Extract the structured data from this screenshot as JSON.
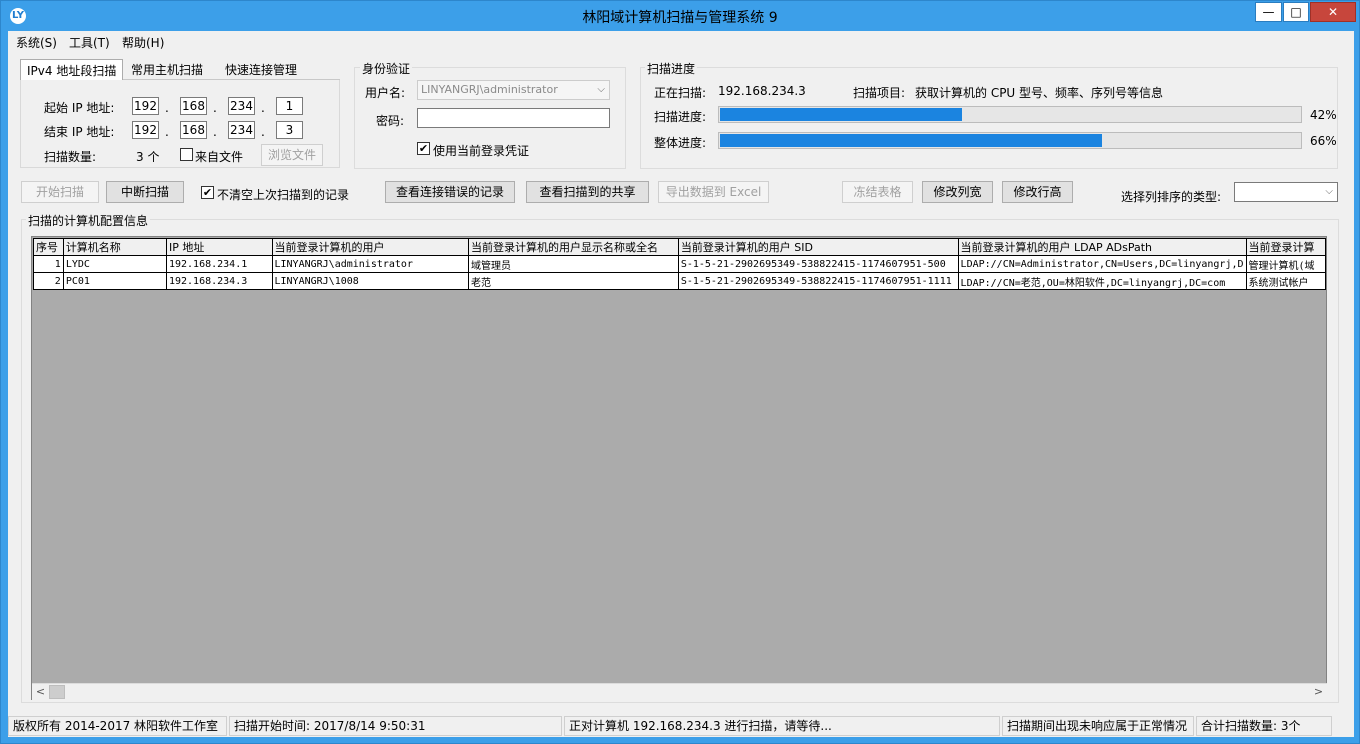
{
  "window": {
    "title": "林阳域计算机扫描与管理系统 9",
    "icon": "app-logo-icon",
    "min_glyph": "—",
    "max_glyph": "□",
    "close_glyph": "✕"
  },
  "menu": [
    "系统(S)",
    "工具(T)",
    "帮助(H)"
  ],
  "scan_tabs": [
    "IPv4 地址段扫描",
    "常用主机扫描",
    "快速连接管理"
  ],
  "ip_scan": {
    "start_label": "起始 IP 地址:",
    "start_ip": [
      "192",
      "168",
      "234",
      "1"
    ],
    "end_label": "结束 IP 地址:",
    "end_ip": [
      "192",
      "168",
      "234",
      "3"
    ],
    "dot": ".",
    "count_label": "扫描数量:",
    "count_value": "3 个",
    "from_file_label": "来自文件",
    "from_file_checked": false,
    "browse_label": "浏览文件"
  },
  "auth": {
    "title": "身份验证",
    "username_label": "用户名:",
    "username_value": "LINYANGRJ\\administrator",
    "password_label": "密码:",
    "password_value": "",
    "use_current_label": "使用当前登录凭证",
    "use_current_checked": true
  },
  "progress": {
    "title": "扫描进度",
    "scanning_label": "正在扫描:",
    "scanning_ip": "192.168.234.3",
    "item_label": "扫描项目:",
    "item_value": "获取计算机的 CPU 型号、频率、序列号等信息",
    "scan_label": "扫描进度:",
    "scan_percent_text": "42%",
    "scan_fraction": 0.42,
    "overall_label": "整体进度:",
    "overall_percent_text": "66%",
    "overall_fraction": 0.66,
    "bar_color": "#1b84e0"
  },
  "toolbar": {
    "start_scan": "开始扫描",
    "stop_scan": "中断扫描",
    "keep_records_label": "不清空上次扫描到的记录",
    "keep_records_checked": true,
    "view_errors": "查看连接错误的记录",
    "view_shares": "查看扫描到的共享",
    "export_excel": "导出数据到 Excel",
    "freeze_table": "冻结表格",
    "col_width": "修改列宽",
    "row_height": "修改行高",
    "sort_type_label": "选择列排序的类型:",
    "sort_type_value": ""
  },
  "results": {
    "title": "扫描的计算机配置信息",
    "columns": [
      "序号",
      "计算机名称",
      "IP 地址",
      "当前登录计算机的用户",
      "当前登录计算机的用户显示名称或全名",
      "当前登录计算机的用户 SID",
      "当前登录计算机的用户 LDAP ADsPath",
      "当前登录计算"
    ],
    "rows": [
      [
        "1",
        "LYDC",
        "192.168.234.1",
        "LINYANGRJ\\administrator",
        "域管理员",
        "S-1-5-21-2902695349-538822415-1174607951-500",
        "LDAP://CN=Administrator,CN=Users,DC=linyangrj,D",
        "管理计算机(域"
      ],
      [
        "2",
        "PC01",
        "192.168.234.3",
        "LINYANGRJ\\1008",
        "老范",
        "S-1-5-21-2902695349-538822415-1174607951-1111",
        "LDAP://CN=老范,OU=林阳软件,DC=linyangrj,DC=com",
        "系统测试帐户"
      ]
    ]
  },
  "scrollbar": {
    "left_glyph": "<",
    "right_glyph": ">"
  },
  "status": {
    "copyright": "版权所有 2014-2017 林阳软件工作室",
    "start_time": "扫描开始时间: 2017/8/14 9:50:31",
    "current": "正对计算机 192.168.234.3 进行扫描，请等待...",
    "hint": "扫描期间出现未响应属于正常情况",
    "total": "合计扫描数量: 3个"
  }
}
